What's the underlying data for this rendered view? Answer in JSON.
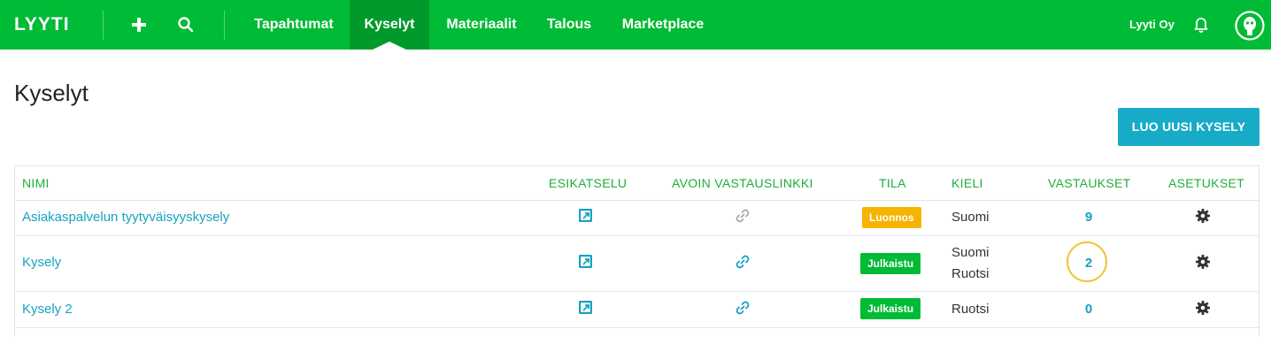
{
  "nav": {
    "logo": "LYYTI",
    "add_icon": "plus-icon",
    "search_icon": "search-icon",
    "items": [
      {
        "label": "Tapahtumat",
        "active": false
      },
      {
        "label": "Kyselyt",
        "active": true
      },
      {
        "label": "Materiaalit",
        "active": false
      },
      {
        "label": "Talous",
        "active": false
      },
      {
        "label": "Marketplace",
        "active": false
      }
    ],
    "organization": "Lyyti Oy",
    "bell_icon": "bell-icon",
    "avatar_icon": "avatar-icon"
  },
  "page": {
    "title": "Kyselyt",
    "new_button": "LUO UUSI KYSELY"
  },
  "table": {
    "headers": {
      "name": "NIMI",
      "preview": "ESIKATSELU",
      "link": "AVOIN VASTAUSLINKKI",
      "status": "TILA",
      "language": "KIELI",
      "responses": "VASTAUKSET",
      "settings": "ASETUKSET"
    },
    "rows": [
      {
        "name": "Asiakaspalvelun tyytyväisyyskysely",
        "status": "Luonnos",
        "status_color": "#f5b400",
        "languages": [
          "Suomi"
        ],
        "responses": "9",
        "link_active": false
      },
      {
        "name": "Kysely",
        "status": "Julkaistu",
        "status_color": "#00bb35",
        "languages": [
          "Suomi",
          "Ruotsi"
        ],
        "responses": "2",
        "link_active": true
      },
      {
        "name": "Kysely 2",
        "status": "Julkaistu",
        "status_color": "#00bb35",
        "languages": [
          "Ruotsi"
        ],
        "responses": "0",
        "link_active": true
      }
    ]
  },
  "colors": {
    "brand": "#00bb35",
    "brand_dark": "#009a2c",
    "link": "#17a2c0",
    "button": "#17abc8",
    "draft": "#f5b400",
    "highlight_ring": "#f5c330"
  }
}
